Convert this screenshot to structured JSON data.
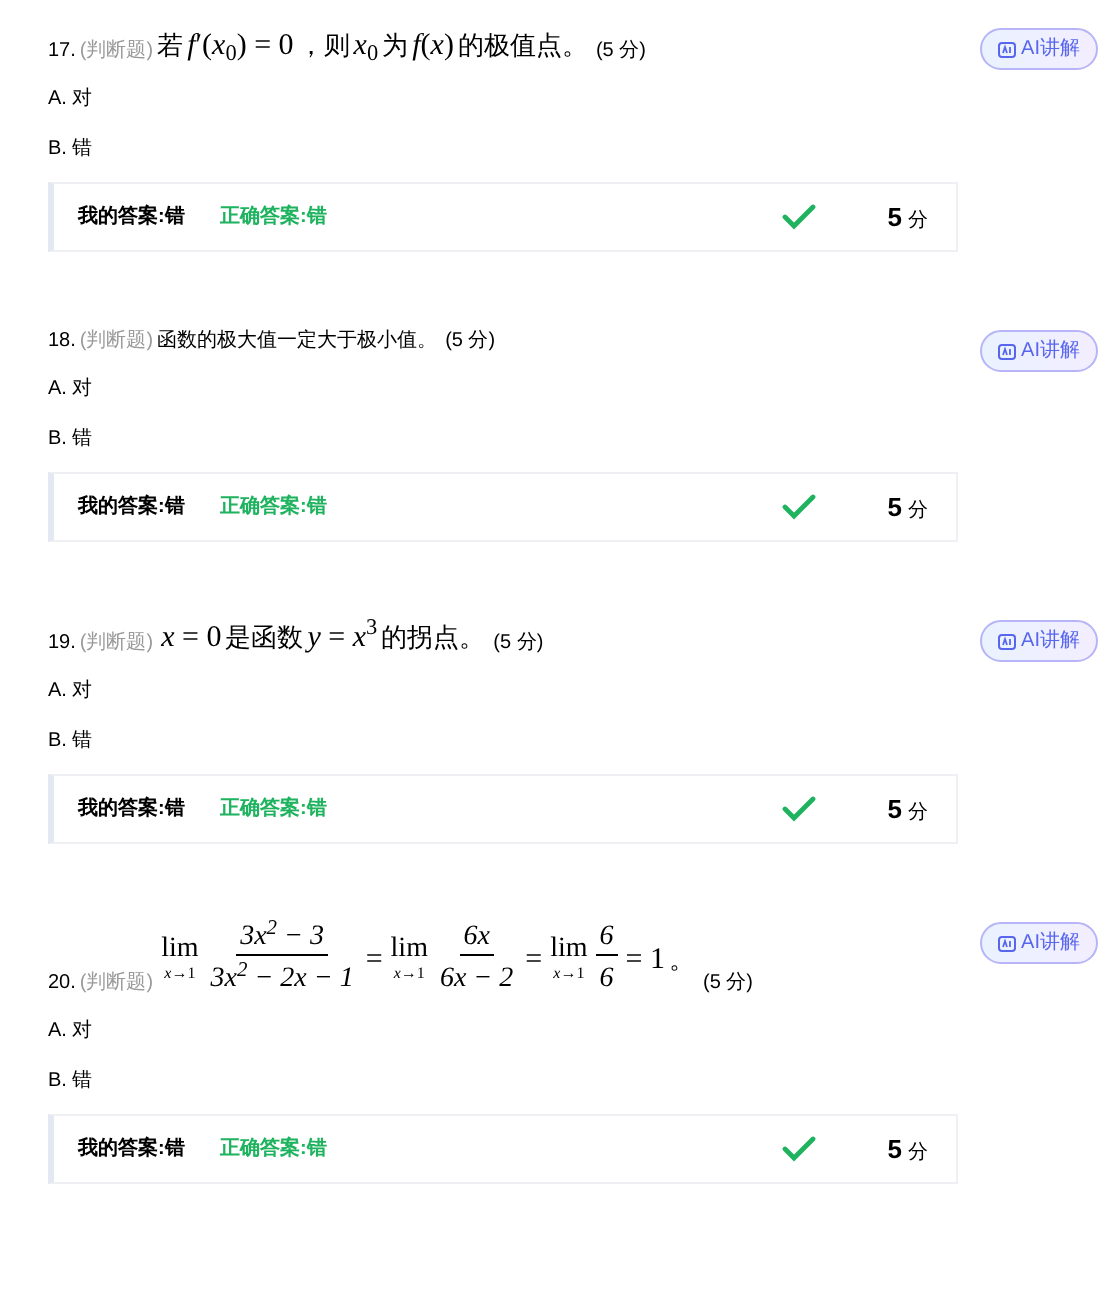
{
  "questions": [
    {
      "number": "17.",
      "type": "(判断题)",
      "stem": [
        {
          "kind": "text",
          "text": "若 "
        },
        {
          "kind": "math",
          "text": "*f*′(*x*$_{0}$) = 0"
        },
        {
          "kind": "text",
          "text": "，则 "
        },
        {
          "kind": "math",
          "text": "*x*$_{0}$"
        },
        {
          "kind": "text",
          "text": "为 "
        },
        {
          "kind": "math",
          "text": "*f*(*x*)"
        },
        {
          "kind": "text",
          "text": " 的极值点。"
        }
      ],
      "score": "(5 分)",
      "options": [
        "A. 对",
        "B. 错"
      ],
      "my_answer": "我的答案:错",
      "correct_answer": "正确答案:错",
      "correct": true,
      "points": "5",
      "unit": "分",
      "ai_button": "AI讲解"
    },
    {
      "number": "18.",
      "type": "(判断题)",
      "stem": [
        {
          "kind": "plain",
          "text": "函数的极大值一定大于极小值。"
        }
      ],
      "score": "(5 分)",
      "options": [
        "A. 对",
        "B. 错"
      ],
      "my_answer": "我的答案:错",
      "correct_answer": "正确答案:错",
      "correct": true,
      "points": "5",
      "unit": "分",
      "ai_button": "AI讲解"
    },
    {
      "number": "19.",
      "type": "(判断题)",
      "stem": [
        {
          "kind": "math",
          "text": "*x* = 0"
        },
        {
          "kind": "text",
          "text": "是函数 "
        },
        {
          "kind": "math",
          "text": "*y* = *x*$^{3}$"
        },
        {
          "kind": "text",
          "text": " 的拐点。"
        }
      ],
      "score": "(5 分)",
      "options": [
        "A. 对",
        "B. 错"
      ],
      "my_answer": "我的答案:错",
      "correct_answer": "正确答案:错",
      "correct": true,
      "points": "5",
      "unit": "分",
      "ai_button": "AI讲解"
    },
    {
      "number": "20.",
      "type": "(判断题)",
      "stem": [
        {
          "kind": "lim",
          "label": "lim",
          "sub": "*x*→1"
        },
        {
          "kind": "frac",
          "num": "3x$^{2}$ − 3",
          "den": "3x$^{2}$ − 2x − 1"
        },
        {
          "kind": "math",
          "text": "="
        },
        {
          "kind": "lim",
          "label": "lim",
          "sub": "*x*→1"
        },
        {
          "kind": "frac",
          "num": "6x",
          "den": "6x − 2"
        },
        {
          "kind": "math",
          "text": "="
        },
        {
          "kind": "lim",
          "label": "lim",
          "sub": "*x*→1"
        },
        {
          "kind": "frac",
          "num": "6",
          "den": "6"
        },
        {
          "kind": "math",
          "text": "= 1"
        },
        {
          "kind": "text",
          "text": "。"
        }
      ],
      "score": "(5 分)",
      "options": [
        "A. 对",
        "B. 错"
      ],
      "my_answer": "我的答案:错",
      "correct_answer": "正确答案:错",
      "correct": true,
      "points": "5",
      "unit": "分",
      "ai_button": "AI讲解"
    }
  ]
}
